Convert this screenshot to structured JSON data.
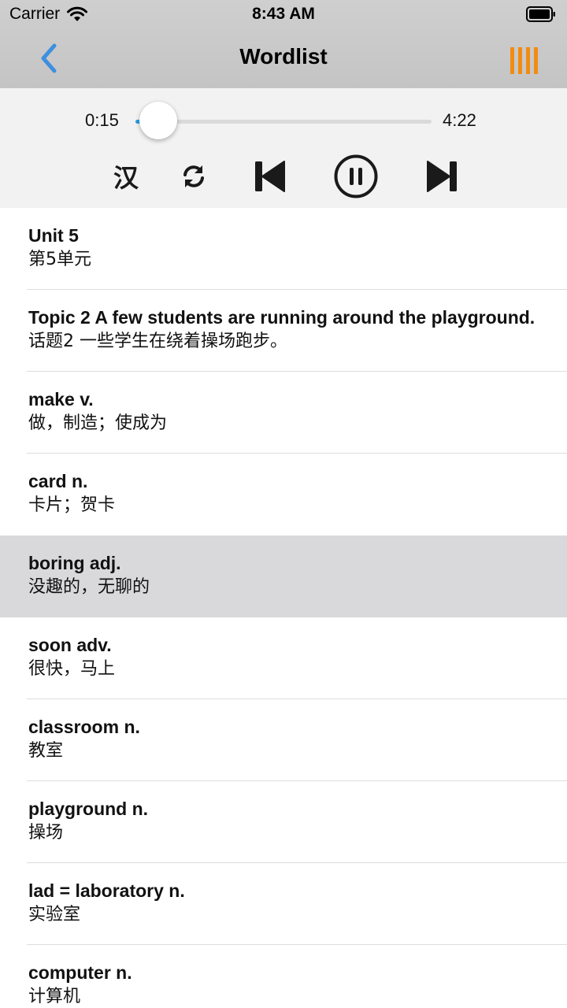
{
  "status_bar": {
    "carrier": "Carrier",
    "time": "8:43 AM"
  },
  "nav": {
    "title": "Wordlist",
    "back_icon": "chevron-left-icon",
    "playlist_icon": "playlist-bars-icon"
  },
  "player": {
    "current_time": "0:15",
    "total_time": "4:22",
    "progress": 0.06,
    "lang_toggle_label": "汉",
    "accent_color": "#2a9fe0"
  },
  "colors": {
    "back_icon": "#3d8fe0",
    "playlist_icon": "#f08c14",
    "selected_row": "#d9d9dc"
  },
  "words": [
    {
      "word": "Unit 5",
      "meaning": "第5单元"
    },
    {
      "word": "Topic 2 A few students are running around the playground.",
      "meaning": "话题2 一些学生在绕着操场跑步。"
    },
    {
      "word": "make v.",
      "meaning": "做，制造；使成为"
    },
    {
      "word": "card n.",
      "meaning": "卡片；贺卡"
    },
    {
      "word": "boring adj.",
      "meaning": "没趣的，无聊的",
      "selected": true
    },
    {
      "word": "soon adv.",
      "meaning": "很快，马上"
    },
    {
      "word": "classroom n.",
      "meaning": "教室"
    },
    {
      "word": "playground n.",
      "meaning": "操场"
    },
    {
      "word": "lad = laboratory n.",
      "meaning": "实验室"
    },
    {
      "word": "computer n.",
      "meaning": "计算机"
    }
  ]
}
